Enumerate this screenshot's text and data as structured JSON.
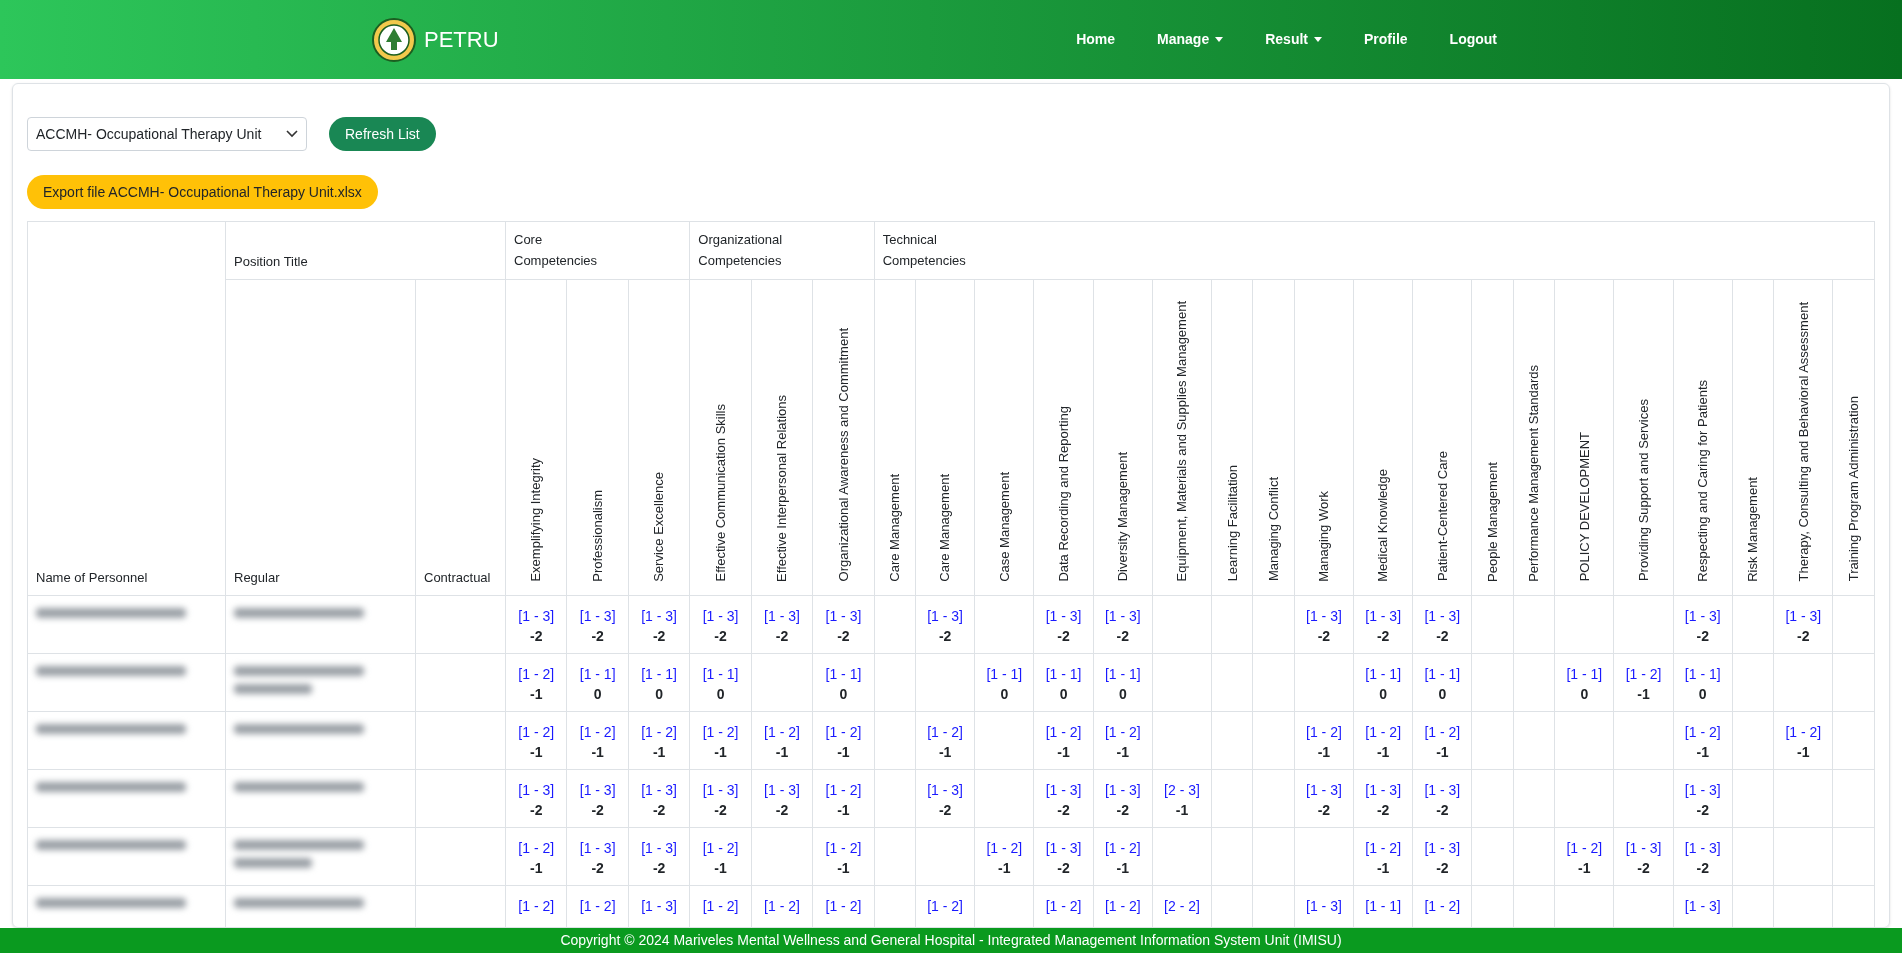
{
  "navbar": {
    "brand": "PETRU",
    "links": [
      {
        "label": "Home",
        "dropdown": false
      },
      {
        "label": "Manage",
        "dropdown": true
      },
      {
        "label": "Result",
        "dropdown": true
      },
      {
        "label": "Profile",
        "dropdown": false
      },
      {
        "label": "Logout",
        "dropdown": false
      }
    ]
  },
  "unit_select": {
    "value": "ACCMH- Occupational Therapy Unit"
  },
  "refresh_button": "Refresh List",
  "export_button": "Export file ACCMH- Occupational Therapy Unit.xlsx",
  "table": {
    "name_header": "Name of Personnel",
    "position_header": "Position Title",
    "position_subheaders": [
      "Regular",
      "Contractual"
    ],
    "groups": [
      {
        "label": "Core Competencies",
        "columns": [
          "Exemplifying Integrity",
          "Professionalism",
          "Service Excellence"
        ]
      },
      {
        "label": "Organizational Competencies",
        "columns": [
          "Effective Communication Skills",
          "Effective Interpersonal Relations",
          "Organizational Awareness and Commitment"
        ]
      },
      {
        "label": "Technical Competencies",
        "columns": [
          "Care Management",
          "Care Management",
          "Case Management",
          "Data Recording and Reporting",
          "Diversity Management",
          "Equipment, Materials and Supplies Management",
          "Learning Facilitation",
          "Managing Conflict",
          "Managing Work",
          "Medical Knowledge",
          "Patient-Centered Care",
          "People Management",
          "Performance Management Standards",
          "POLICY DEVELOPMENT",
          "Providing Support and Services",
          "Respecting and Caring for Patients",
          "Risk Management",
          "Therapy, Consulting and Behavioral Assessment",
          "Training Program Administration"
        ]
      }
    ],
    "rows": [
      {
        "cells": [
          {
            "code": "[1 - 3]",
            "score": "-2"
          },
          {
            "code": "[1 - 3]",
            "score": "-2"
          },
          {
            "code": "[1 - 3]",
            "score": "-2"
          },
          {
            "code": "[1 - 3]",
            "score": "-2"
          },
          {
            "code": "[1 - 3]",
            "score": "-2"
          },
          {
            "code": "[1 - 3]",
            "score": "-2"
          },
          null,
          {
            "code": "[1 - 3]",
            "score": "-2"
          },
          null,
          {
            "code": "[1 - 3]",
            "score": "-2"
          },
          {
            "code": "[1 - 3]",
            "score": "-2"
          },
          null,
          null,
          null,
          {
            "code": "[1 - 3]",
            "score": "-2"
          },
          {
            "code": "[1 - 3]",
            "score": "-2"
          },
          {
            "code": "[1 - 3]",
            "score": "-2"
          },
          null,
          null,
          null,
          null,
          {
            "code": "[1 - 3]",
            "score": "-2"
          },
          null,
          {
            "code": "[1 - 3]",
            "score": "-2"
          },
          null
        ]
      },
      {
        "cells": [
          {
            "code": "[1 - 2]",
            "score": "-1"
          },
          {
            "code": "[1 - 1]",
            "score": "0"
          },
          {
            "code": "[1 - 1]",
            "score": "0"
          },
          {
            "code": "[1 - 1]",
            "score": "0"
          },
          null,
          {
            "code": "[1 - 1]",
            "score": "0"
          },
          null,
          null,
          {
            "code": "[1 - 1]",
            "score": "0"
          },
          {
            "code": "[1 - 1]",
            "score": "0"
          },
          {
            "code": "[1 - 1]",
            "score": "0"
          },
          null,
          null,
          null,
          null,
          {
            "code": "[1 - 1]",
            "score": "0"
          },
          {
            "code": "[1 - 1]",
            "score": "0"
          },
          null,
          null,
          {
            "code": "[1 - 1]",
            "score": "0"
          },
          {
            "code": "[1 - 2]",
            "score": "-1"
          },
          {
            "code": "[1 - 1]",
            "score": "0"
          },
          null,
          null,
          null
        ]
      },
      {
        "cells": [
          {
            "code": "[1 - 2]",
            "score": "-1"
          },
          {
            "code": "[1 - 2]",
            "score": "-1"
          },
          {
            "code": "[1 - 2]",
            "score": "-1"
          },
          {
            "code": "[1 - 2]",
            "score": "-1"
          },
          {
            "code": "[1 - 2]",
            "score": "-1"
          },
          {
            "code": "[1 - 2]",
            "score": "-1"
          },
          null,
          {
            "code": "[1 - 2]",
            "score": "-1"
          },
          null,
          {
            "code": "[1 - 2]",
            "score": "-1"
          },
          {
            "code": "[1 - 2]",
            "score": "-1"
          },
          null,
          null,
          null,
          {
            "code": "[1 - 2]",
            "score": "-1"
          },
          {
            "code": "[1 - 2]",
            "score": "-1"
          },
          {
            "code": "[1 - 2]",
            "score": "-1"
          },
          null,
          null,
          null,
          null,
          {
            "code": "[1 - 2]",
            "score": "-1"
          },
          null,
          {
            "code": "[1 - 2]",
            "score": "-1"
          },
          null
        ]
      },
      {
        "cells": [
          {
            "code": "[1 - 3]",
            "score": "-2"
          },
          {
            "code": "[1 - 3]",
            "score": "-2"
          },
          {
            "code": "[1 - 3]",
            "score": "-2"
          },
          {
            "code": "[1 - 3]",
            "score": "-2"
          },
          {
            "code": "[1 - 3]",
            "score": "-2"
          },
          {
            "code": "[1 - 2]",
            "score": "-1"
          },
          null,
          {
            "code": "[1 - 3]",
            "score": "-2"
          },
          null,
          {
            "code": "[1 - 3]",
            "score": "-2"
          },
          {
            "code": "[1 - 3]",
            "score": "-2"
          },
          {
            "code": "[2 - 3]",
            "score": "-1"
          },
          null,
          null,
          {
            "code": "[1 - 3]",
            "score": "-2"
          },
          {
            "code": "[1 - 3]",
            "score": "-2"
          },
          {
            "code": "[1 - 3]",
            "score": "-2"
          },
          null,
          null,
          null,
          null,
          {
            "code": "[1 - 3]",
            "score": "-2"
          },
          null,
          null,
          null
        ]
      },
      {
        "cells": [
          {
            "code": "[1 - 2]",
            "score": "-1"
          },
          {
            "code": "[1 - 3]",
            "score": "-2"
          },
          {
            "code": "[1 - 3]",
            "score": "-2"
          },
          {
            "code": "[1 - 2]",
            "score": "-1"
          },
          null,
          {
            "code": "[1 - 2]",
            "score": "-1"
          },
          null,
          null,
          {
            "code": "[1 - 2]",
            "score": "-1"
          },
          {
            "code": "[1 - 3]",
            "score": "-2"
          },
          {
            "code": "[1 - 2]",
            "score": "-1"
          },
          null,
          null,
          null,
          null,
          {
            "code": "[1 - 2]",
            "score": "-1"
          },
          {
            "code": "[1 - 3]",
            "score": "-2"
          },
          null,
          null,
          {
            "code": "[1 - 2]",
            "score": "-1"
          },
          {
            "code": "[1 - 3]",
            "score": "-2"
          },
          {
            "code": "[1 - 3]",
            "score": "-2"
          },
          null,
          null,
          null
        ]
      },
      {
        "cells": [
          {
            "code": "[1 - 2]"
          },
          {
            "code": "[1 - 2]"
          },
          {
            "code": "[1 - 3]"
          },
          {
            "code": "[1 - 2]"
          },
          {
            "code": "[1 - 2]"
          },
          {
            "code": "[1 - 2]"
          },
          null,
          {
            "code": "[1 - 2]"
          },
          null,
          {
            "code": "[1 - 2]"
          },
          {
            "code": "[1 - 2]"
          },
          {
            "code": "[2 - 2]"
          },
          null,
          null,
          {
            "code": "[1 - 3]"
          },
          {
            "code": "[1 - 1]"
          },
          {
            "code": "[1 - 2]"
          },
          null,
          null,
          null,
          null,
          {
            "code": "[1 - 3]"
          },
          null,
          null,
          null
        ]
      }
    ]
  },
  "footer": "Copyright © 2024 Mariveles Mental Wellness and General Hospital - Integrated Management Information System Unit (IMISU)"
}
